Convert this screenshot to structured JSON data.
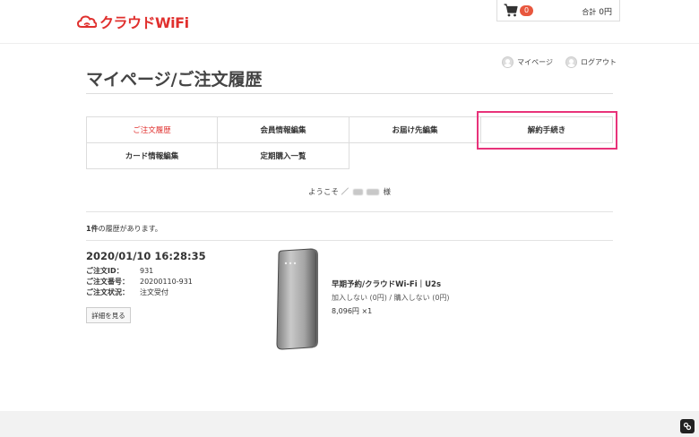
{
  "header": {
    "logo_text": "クラウドWiFi",
    "cart_badge": "0",
    "cart_total_label": "合計",
    "cart_total_value": "0円"
  },
  "page": {
    "title": "マイページ/ご注文履歴",
    "mypage_link": "マイページ",
    "logout_link": "ログアウト"
  },
  "menu": {
    "items": [
      {
        "label": "ご注文履歴"
      },
      {
        "label": "会員情報編集"
      },
      {
        "label": "お届け先編集"
      },
      {
        "label": "解約手続き"
      },
      {
        "label": "カード情報編集"
      },
      {
        "label": "定期購入一覧"
      }
    ]
  },
  "welcome": {
    "prefix": "ようこそ ／",
    "suffix": "様"
  },
  "history": {
    "count_num": "1件",
    "count_text": "の履歴があります。"
  },
  "order": {
    "date": "2020/01/10 16:28:35",
    "fields": [
      {
        "label": "ご注文ID：",
        "value": "931"
      },
      {
        "label": "ご注文番号：",
        "value": "20200110-931"
      },
      {
        "label": "ご注文状況：",
        "value": "注文受付"
      }
    ],
    "detail_button": "詳細を見る",
    "product_name": "早期予約/クラウドWi-Fi｜U2s",
    "product_option": "加入しない (0円) / 購入しない (0円)",
    "product_price": "8,096円 ×1"
  },
  "colors": {
    "brand_red": "#e0302e",
    "highlight_pink": "#e8337a"
  }
}
